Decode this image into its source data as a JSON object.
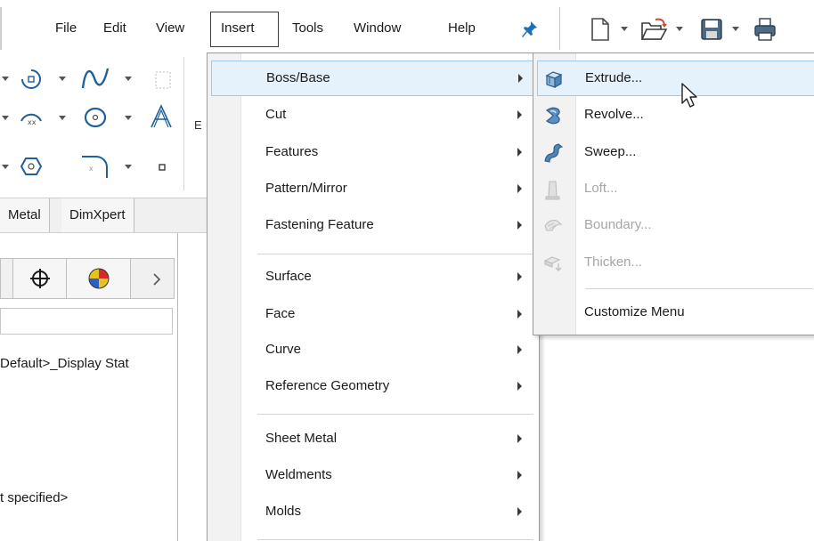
{
  "menubar": {
    "items": [
      "File",
      "Edit",
      "View",
      "Insert",
      "Tools",
      "Window",
      "Help"
    ],
    "active": "Insert"
  },
  "command_manager": {
    "partial_label": "E",
    "tabs": [
      "Metal",
      "DimXpert"
    ]
  },
  "feature_tree": {
    "display_state_text": "Default>_Display Stat",
    "material_text": "t specified>"
  },
  "insert_menu": {
    "groups": [
      [
        "Boss/Base",
        "Cut",
        "Features",
        "Pattern/Mirror",
        "Fastening Feature"
      ],
      [
        "Surface",
        "Face",
        "Curve",
        "Reference Geometry"
      ],
      [
        "Sheet Metal",
        "Weldments",
        "Molds"
      ]
    ],
    "highlighted": "Boss/Base"
  },
  "boss_base_submenu": {
    "items": [
      {
        "label": "Extrude...",
        "icon": "extrude-icon",
        "enabled": true
      },
      {
        "label": "Revolve...",
        "icon": "revolve-icon",
        "enabled": true
      },
      {
        "label": "Sweep...",
        "icon": "sweep-icon",
        "enabled": true
      },
      {
        "label": "Loft...",
        "icon": "loft-icon",
        "enabled": false
      },
      {
        "label": "Boundary...",
        "icon": "boundary-icon",
        "enabled": false
      },
      {
        "label": "Thicken...",
        "icon": "thicken-icon",
        "enabled": false
      }
    ],
    "customize_label": "Customize Menu",
    "highlighted": "Extrude..."
  },
  "colors": {
    "highlight_bg": "#e5f1fb",
    "highlight_border": "#9fc9ee",
    "disabled_text": "#a6a6a6",
    "pin_blue": "#1f6fb8"
  }
}
